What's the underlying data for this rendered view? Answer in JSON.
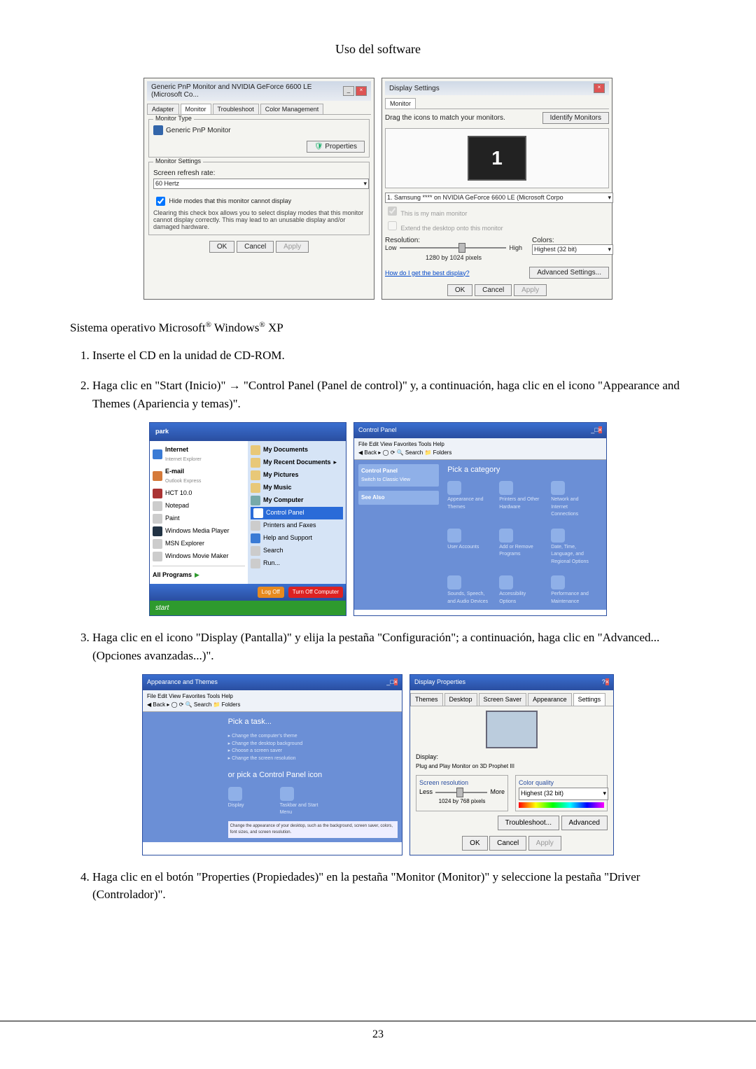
{
  "header_title": "Uso del software",
  "page_number": "23",
  "dlg_monitor": {
    "title": "Generic PnP Monitor and NVIDIA GeForce 6600 LE (Microsoft Co...",
    "tabs": [
      "Adapter",
      "Monitor",
      "Troubleshoot",
      "Color Management"
    ],
    "group_type_title": "Monitor Type",
    "monitor_type_value": "Generic PnP Monitor",
    "properties_btn": "Properties",
    "group_settings_title": "Monitor Settings",
    "refresh_label": "Screen refresh rate:",
    "refresh_value": "60 Hertz",
    "hide_modes_chk": "Hide modes that this monitor cannot display",
    "hide_modes_desc": "Clearing this check box allows you to select display modes that this monitor cannot display correctly. This may lead to an unusable display and/or damaged hardware.",
    "ok": "OK",
    "cancel": "Cancel",
    "apply": "Apply"
  },
  "dlg_display_settings": {
    "title": "Display Settings",
    "tab": "Monitor",
    "drag_text": "Drag the icons to match your monitors.",
    "identify_btn": "Identify Monitors",
    "big_num": "1",
    "device_dd": "1. Samsung **** on NVIDIA GeForce 6600 LE (Microsoft Corpo",
    "main_chk": "This is my main monitor",
    "extend_chk": "Extend the desktop onto this monitor",
    "resolution_label": "Resolution:",
    "res_low": "Low",
    "res_high": "High",
    "res_value": "1280 by 1024 pixels",
    "colors_label": "Colors:",
    "colors_value": "Highest (32 bit)",
    "best_link": "How do I get the best display?",
    "adv_btn": "Advanced Settings...",
    "ok": "OK",
    "cancel": "Cancel",
    "apply": "Apply"
  },
  "os_line_prefix": "Sistema operativo Microsoft",
  "os_line_mid": " Windows",
  "os_line_suffix": " XP",
  "steps": {
    "s1": "Inserte el CD en la unidad de CD-ROM.",
    "s2": "Haga clic en \"Start (Inicio)\" → \"Control Panel (Panel de control)\" y, a continuación, haga clic en el icono \"Appearance and Themes (Apariencia y temas)\".",
    "s3": "Haga clic en el icono \"Display (Pantalla)\" y elija la pestaña \"Configuración\"; a continuación, haga clic en \"Advanced... (Opciones avanzadas...)\".",
    "s4": "Haga clic en el botón \"Properties (Propiedades)\" en la pestaña \"Monitor (Monitor)\" y seleccione la pestaña \"Driver (Controlador)\"."
  },
  "startmenu": {
    "user": "park",
    "left": [
      "Internet",
      "E-mail",
      "HCT 10.0",
      "Notepad",
      "Paint",
      "Windows Media Player",
      "MSN Explorer",
      "Windows Movie Maker",
      "All Programs"
    ],
    "left_sub": {
      "0": "Internet Explorer",
      "1": "Outlook Express"
    },
    "right": [
      "My Documents",
      "My Recent Documents",
      "My Pictures",
      "My Music",
      "My Computer",
      "Control Panel",
      "Printers and Faxes",
      "Help and Support",
      "Search",
      "Run..."
    ],
    "logoff": "Log Off",
    "turnoff": "Turn Off Computer",
    "start": "start"
  },
  "cpanel1": {
    "title": "Control Panel",
    "side_title": "Control Panel",
    "side_link": "Switch to Classic View",
    "see_also": "See Also",
    "cat_title": "Pick a category",
    "items": [
      "Appearance and Themes",
      "Printers and Other Hardware",
      "Network and Internet Connections",
      "User Accounts",
      "Add or Remove Programs",
      "Date, Time, Language, and Regional Options",
      "Sounds, Speech, and Audio Devices",
      "Accessibility Options",
      "Performance and Maintenance"
    ]
  },
  "cpanel2": {
    "title": "Appearance and Themes",
    "task_title": "Pick a task...",
    "tasks": [
      "Change the computer's theme",
      "Change the desktop background",
      "Choose a screen saver",
      "Change the screen resolution"
    ],
    "or_title": "or pick a Control Panel icon",
    "icons": [
      "Display",
      "Taskbar and Start Menu"
    ],
    "icon_desc": "Change the appearance of your desktop, such as the background, screen saver, colors, font sizes, and screen resolution."
  },
  "dispprop": {
    "title": "Display Properties",
    "tabs": [
      "Themes",
      "Desktop",
      "Screen Saver",
      "Appearance",
      "Settings"
    ],
    "display_label": "Display:",
    "display_value": "Plug and Play Monitor on 3D Prophet III",
    "res_label": "Screen resolution",
    "less": "Less",
    "more": "More",
    "res_value": "1024 by 768 pixels",
    "color_label": "Color quality",
    "color_value": "Highest (32 bit)",
    "troubleshoot": "Troubleshoot...",
    "advanced": "Advanced",
    "ok": "OK",
    "cancel": "Cancel",
    "apply": "Apply"
  }
}
